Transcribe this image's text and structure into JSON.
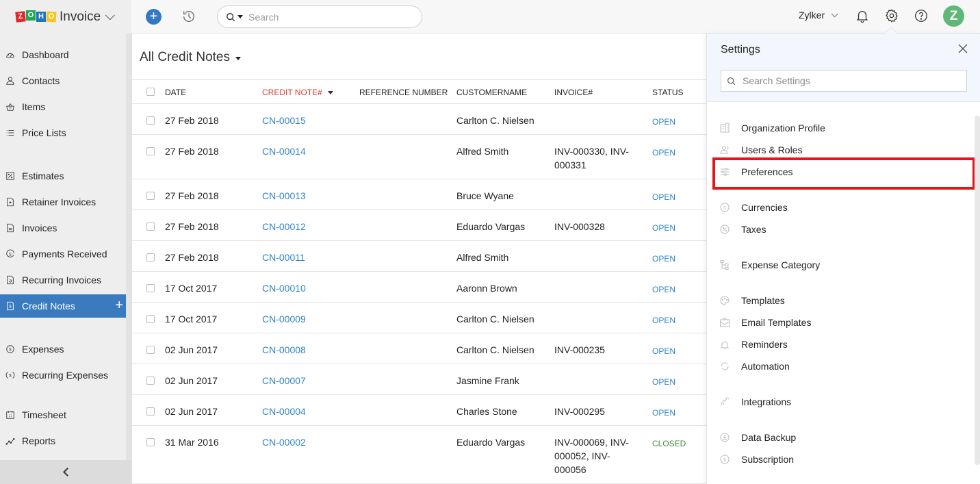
{
  "app": {
    "brand_letters": [
      "Z",
      "O",
      "H",
      "O"
    ],
    "product_name": "Invoice"
  },
  "topbar": {
    "search_placeholder": "Search",
    "org_name": "Zylker",
    "avatar_initial": "Z",
    "icons": [
      "plus-icon",
      "history-icon",
      "search-icon",
      "bell-icon",
      "gear-icon",
      "help-icon"
    ]
  },
  "sidebar": {
    "items": [
      {
        "label": "Dashboard",
        "icon": "dashboard-icon"
      },
      {
        "label": "Contacts",
        "icon": "contacts-icon"
      },
      {
        "label": "Items",
        "icon": "items-icon"
      },
      {
        "label": "Price Lists",
        "icon": "list-icon"
      },
      {
        "label": "Estimates",
        "icon": "estimates-icon"
      },
      {
        "label": "Retainer Invoices",
        "icon": "retainer-invoice-icon"
      },
      {
        "label": "Invoices",
        "icon": "invoice-icon"
      },
      {
        "label": "Payments Received",
        "icon": "payment-icon"
      },
      {
        "label": "Recurring Invoices",
        "icon": "recurring-invoice-icon"
      },
      {
        "label": "Credit Notes",
        "icon": "credit-note-icon",
        "active": true
      },
      {
        "label": "Expenses",
        "icon": "expense-icon"
      },
      {
        "label": "Recurring Expenses",
        "icon": "recurring-expense-icon"
      },
      {
        "label": "Timesheet",
        "icon": "timesheet-icon"
      },
      {
        "label": "Reports",
        "icon": "reports-icon"
      }
    ]
  },
  "main": {
    "view_title": "All Credit Notes",
    "columns": [
      "DATE",
      "CREDIT NOTE#",
      "REFERENCE NUMBER",
      "CUSTOMERNAME",
      "INVOICE#",
      "STATUS"
    ],
    "sorted_column": "CREDIT NOTE#",
    "rows": [
      {
        "date": "27 Feb 2018",
        "credit_note": "CN-00015",
        "reference": "",
        "customer": "Carlton C. Nielsen",
        "invoice": "",
        "status": "OPEN"
      },
      {
        "date": "27 Feb 2018",
        "credit_note": "CN-00014",
        "reference": "",
        "customer": "Alfred Smith",
        "invoice": "INV-000330, INV-000331",
        "status": "OPEN"
      },
      {
        "date": "27 Feb 2018",
        "credit_note": "CN-00013",
        "reference": "",
        "customer": "Bruce Wyane",
        "invoice": "",
        "status": "OPEN"
      },
      {
        "date": "27 Feb 2018",
        "credit_note": "CN-00012",
        "reference": "",
        "customer": "Eduardo Vargas",
        "invoice": "INV-000328",
        "status": "OPEN"
      },
      {
        "date": "27 Feb 2018",
        "credit_note": "CN-00011",
        "reference": "",
        "customer": "Alfred Smith",
        "invoice": "",
        "status": "OPEN"
      },
      {
        "date": "17 Oct 2017",
        "credit_note": "CN-00010",
        "reference": "",
        "customer": "Aaronn Brown",
        "invoice": "",
        "status": "OPEN"
      },
      {
        "date": "17 Oct 2017",
        "credit_note": "CN-00009",
        "reference": "",
        "customer": "Carlton C. Nielsen",
        "invoice": "",
        "status": "OPEN"
      },
      {
        "date": "02 Jun 2017",
        "credit_note": "CN-00008",
        "reference": "",
        "customer": "Carlton C. Nielsen",
        "invoice": "INV-000235",
        "status": "OPEN"
      },
      {
        "date": "02 Jun 2017",
        "credit_note": "CN-00007",
        "reference": "",
        "customer": "Jasmine Frank",
        "invoice": "",
        "status": "OPEN"
      },
      {
        "date": "02 Jun 2017",
        "credit_note": "CN-00004",
        "reference": "",
        "customer": "Charles Stone",
        "invoice": "INV-000295",
        "status": "OPEN"
      },
      {
        "date": "31 Mar 2016",
        "credit_note": "CN-00002",
        "reference": "",
        "customer": "Eduardo Vargas",
        "invoice": "INV-000069, INV-000052, INV-000056",
        "status": "CLOSED"
      }
    ]
  },
  "settings": {
    "title": "Settings",
    "search_placeholder": "Search Settings",
    "highlighted_item": "Preferences",
    "highlight_color": "#e8141c",
    "items": [
      {
        "label": "Organization Profile",
        "icon": "building-icon"
      },
      {
        "label": "Users & Roles",
        "icon": "users-icon"
      },
      {
        "label": "Preferences",
        "icon": "sliders-icon"
      },
      {
        "label": "Currencies",
        "icon": "currency-icon"
      },
      {
        "label": "Taxes",
        "icon": "tax-icon"
      },
      {
        "label": "Expense Category",
        "icon": "category-tree-icon"
      },
      {
        "label": "Templates",
        "icon": "palette-icon"
      },
      {
        "label": "Email Templates",
        "icon": "email-template-icon"
      },
      {
        "label": "Reminders",
        "icon": "bell-icon"
      },
      {
        "label": "Automation",
        "icon": "automation-icon"
      },
      {
        "label": "Integrations",
        "icon": "plug-icon"
      },
      {
        "label": "Data Backup",
        "icon": "backup-icon"
      },
      {
        "label": "Subscription",
        "icon": "subscription-icon"
      }
    ]
  },
  "colors": {
    "accent": "#3a7bbf",
    "link": "#2f83c7",
    "sorted_header": "#d93b32",
    "status_open": "#2f83c7",
    "status_closed": "#3d8e3d",
    "avatar": "#5fb878"
  }
}
